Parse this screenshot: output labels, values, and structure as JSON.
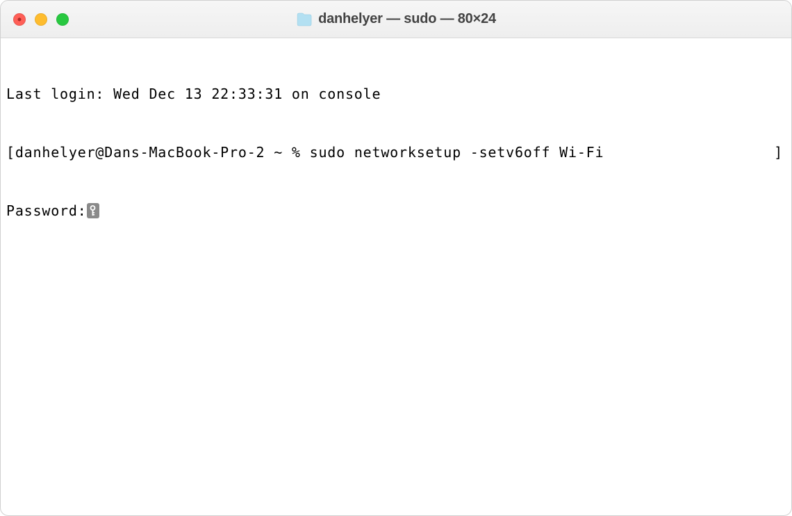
{
  "window": {
    "title": "danhelyer — sudo — 80×24"
  },
  "terminal": {
    "last_login": "Last login: Wed Dec 13 22:33:31 on console",
    "prompt_left_bracket": "[",
    "prompt_user_host": "danhelyer@Dans-MacBook-Pro-2 ~ % ",
    "command": "sudo networksetup -setv6off Wi-Fi",
    "prompt_right_bracket": "]",
    "password_label": "Password:",
    "key_icon": "key-icon"
  },
  "traffic": {
    "close": "close-window",
    "minimize": "minimize-window",
    "maximize": "maximize-window"
  }
}
